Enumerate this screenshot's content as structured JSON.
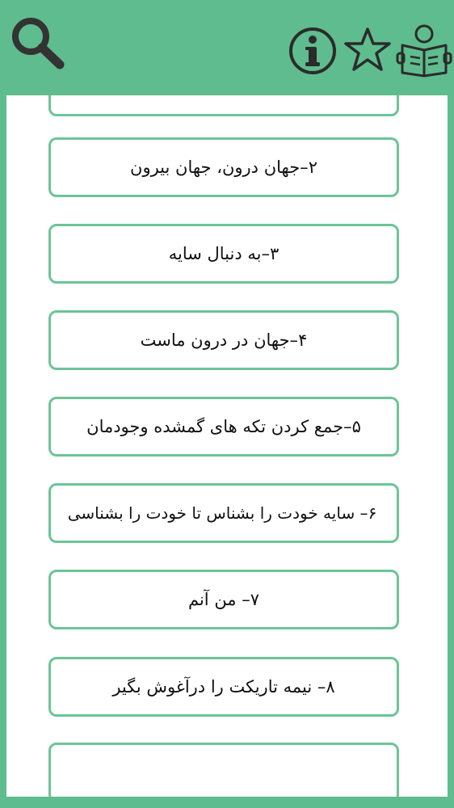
{
  "header": {
    "icons": [
      "search-icon",
      "info-icon",
      "star-icon",
      "book-reader-icon"
    ]
  },
  "items": [
    {
      "label": ""
    },
    {
      "label": "۲–جهان درون، جهان بیرون"
    },
    {
      "label": "۳–به دنبال سایه"
    },
    {
      "label": "۴–جهان در درون ماست"
    },
    {
      "label": "۵–جمع کردن تکه های گمشده وجودمان"
    },
    {
      "label": "۶– سایه خودت را بشناس تا خودت را بشناسی"
    },
    {
      "label": "۷– من آنم"
    },
    {
      "label": "۸– نیمه تاریکت را درآغوش بگیر"
    },
    {
      "label": ""
    }
  ],
  "colors": {
    "accent": "#5fbc8e",
    "border": "#6cc497",
    "icon": "#2b2b2b"
  }
}
